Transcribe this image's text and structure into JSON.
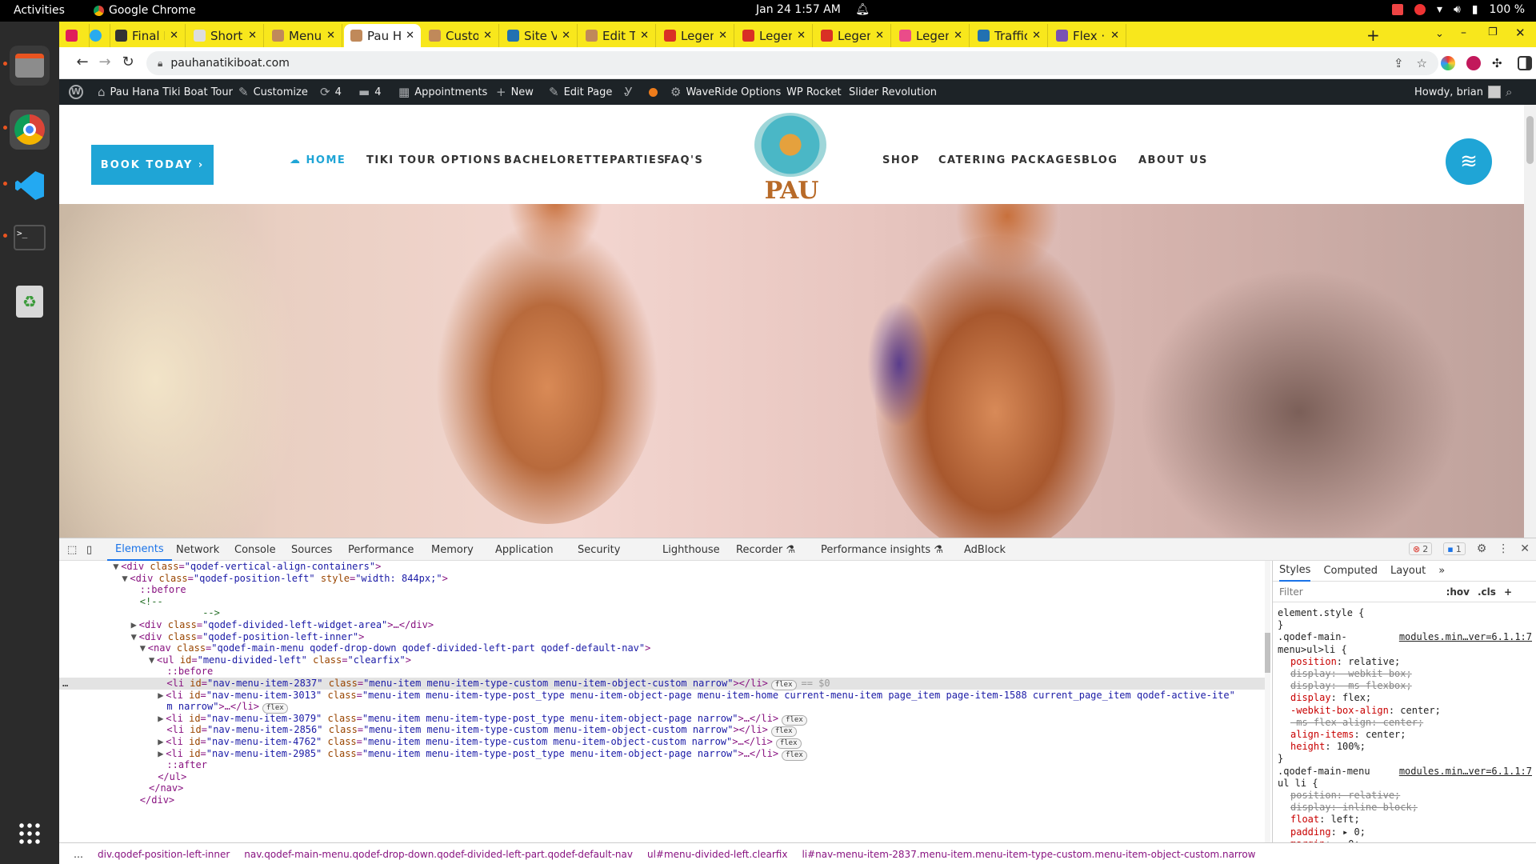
{
  "system_bar": {
    "activities": "Activities",
    "app_name": "Google Chrome",
    "clock": "Jan 24  1:57 AM",
    "battery": "100 %"
  },
  "tabs": [
    {
      "title": "",
      "favicon_color": "#e01e5a"
    },
    {
      "title": "",
      "favicon_color": "#2aabee"
    },
    {
      "title": "Final De",
      "favicon_color": "#333333"
    },
    {
      "title": "Short Sl",
      "favicon_color": "#dddddd"
    },
    {
      "title": "Menus «",
      "favicon_color": "#c0895a"
    },
    {
      "title": "Pau Han",
      "favicon_color": "#c0895a",
      "active": true
    },
    {
      "title": "Custom",
      "favicon_color": "#c0895a"
    },
    {
      "title": "Site Ver",
      "favicon_color": "#2271b1"
    },
    {
      "title": "Edit The",
      "favicon_color": "#c0895a"
    },
    {
      "title": "Legend",
      "favicon_color": "#d93025"
    },
    {
      "title": "Legend",
      "favicon_color": "#d93025"
    },
    {
      "title": "Legend",
      "favicon_color": "#d93025"
    },
    {
      "title": "Legend",
      "favicon_color": "#ea4c89"
    },
    {
      "title": "Traffic S",
      "favicon_color": "#2271b1"
    },
    {
      "title": "Flex · Bo",
      "favicon_color": "#7952b3"
    }
  ],
  "omnibox": {
    "url": "pauhanatikiboat.com"
  },
  "wp_admin_bar": {
    "site_name": "Pau Hana Tiki Boat Tour",
    "customize": "Customize",
    "updates_count": "4",
    "comments_count": "4",
    "appointments": "Appointments",
    "new": "New",
    "edit_page": "Edit Page",
    "waveride": "WaveRide Options",
    "wp_rocket": "WP Rocket",
    "slider_revolution": "Slider Revolution",
    "howdy": "Howdy, brian"
  },
  "site": {
    "book_button": "BOOK TODAY ›",
    "menu_left": [
      "HOME",
      "TIKI TOUR OPTIONS",
      "BACHELORETTEPARTIES",
      "FAQ'S"
    ],
    "menu_right": [
      "SHOP",
      "CATERING PACKAGES",
      "BLOG",
      "ABOUT US"
    ],
    "logo_text": "PAU HANA",
    "accent_color": "#1fa5d6"
  },
  "devtools": {
    "tabs": [
      "Elements",
      "Network",
      "Console",
      "Sources",
      "Performance",
      "Memory",
      "Application",
      "Security",
      "Lighthouse",
      "Recorder",
      "Performance insights",
      "AdBlock"
    ],
    "error_count": "2",
    "message_count": "1",
    "dom_lines": [
      {
        "indent": 6,
        "tri": "▼",
        "open": "<div ",
        "attrs": [
          [
            "class",
            "qodef-vertical-align-containers"
          ]
        ],
        "close": ">",
        "after": ""
      },
      {
        "indent": 7,
        "tri": "▼",
        "open": "<div ",
        "attrs": [
          [
            "class",
            "qodef-position-left"
          ],
          [
            "style",
            "width: 844px;"
          ]
        ],
        "close": ">",
        "after": ""
      },
      {
        "indent": 9,
        "tri": "",
        "pseudo": "::before"
      },
      {
        "indent": 9,
        "tri": "",
        "comment": "<!--"
      },
      {
        "indent": 16,
        "tri": "",
        "comment": "-->"
      },
      {
        "indent": 8,
        "tri": "▶",
        "open": "<div ",
        "attrs": [
          [
            "class",
            "qodef-divided-left-widget-area"
          ]
        ],
        "close": ">…</div>",
        "after": ""
      },
      {
        "indent": 8,
        "tri": "▼",
        "open": "<div ",
        "attrs": [
          [
            "class",
            "qodef-position-left-inner"
          ]
        ],
        "close": ">",
        "after": ""
      },
      {
        "indent": 9,
        "tri": "▼",
        "open": "<nav ",
        "attrs": [
          [
            "class",
            "qodef-main-menu qodef-drop-down qodef-divided-left-part qodef-default-nav"
          ]
        ],
        "close": ">",
        "after": ""
      },
      {
        "indent": 10,
        "tri": "▼",
        "open": "<ul ",
        "attrs": [
          [
            "id",
            "menu-divided-left"
          ],
          [
            "class",
            "clearfix"
          ]
        ],
        "close": ">",
        "after": ""
      },
      {
        "indent": 12,
        "tri": "",
        "pseudo": "::before"
      },
      {
        "indent": 12,
        "tri": "",
        "open": "<li ",
        "attrs": [
          [
            "id",
            "nav-menu-item-2837"
          ],
          [
            "class",
            "menu-item menu-item-type-custom menu-item-object-custom  narrow"
          ]
        ],
        "close": "></li>",
        "pill": "flex",
        "after": "== $0",
        "highlight": true
      },
      {
        "indent": 11,
        "tri": "▶",
        "open": "<li ",
        "attrs": [
          [
            "id",
            "nav-menu-item-3013"
          ],
          [
            "class",
            "menu-item menu-item-type-post_type menu-item-object-page menu-item-home current-menu-item page_item page-item-1588 current_page_item qodef-active-ite"
          ]
        ],
        "close": "",
        "after": ""
      },
      {
        "indent": 12,
        "tri": "",
        "wrap": "m narrow\">…</li>",
        "pill": "flex"
      },
      {
        "indent": 11,
        "tri": "▶",
        "open": "<li ",
        "attrs": [
          [
            "id",
            "nav-menu-item-3079"
          ],
          [
            "class",
            "menu-item menu-item-type-post_type menu-item-object-page  narrow"
          ]
        ],
        "close": ">…</li>",
        "pill": "flex"
      },
      {
        "indent": 12,
        "tri": "",
        "open": "<li ",
        "attrs": [
          [
            "id",
            "nav-menu-item-2856"
          ],
          [
            "class",
            "menu-item menu-item-type-custom menu-item-object-custom  narrow"
          ]
        ],
        "close": "></li>",
        "pill": "flex"
      },
      {
        "indent": 11,
        "tri": "▶",
        "open": "<li ",
        "attrs": [
          [
            "id",
            "nav-menu-item-4762"
          ],
          [
            "class",
            "menu-item menu-item-type-custom menu-item-object-custom  narrow"
          ]
        ],
        "close": ">…</li>",
        "pill": "flex"
      },
      {
        "indent": 11,
        "tri": "▶",
        "open": "<li ",
        "attrs": [
          [
            "id",
            "nav-menu-item-2985"
          ],
          [
            "class",
            "menu-item menu-item-type-post_type menu-item-object-page  narrow"
          ]
        ],
        "close": ">…</li>",
        "pill": "flex"
      },
      {
        "indent": 12,
        "tri": "",
        "pseudo": "::after"
      },
      {
        "indent": 11,
        "tri": "",
        "endtag": "</ul>"
      },
      {
        "indent": 10,
        "tri": "",
        "endtag": "</nav>"
      },
      {
        "indent": 9,
        "tri": "",
        "endtag": "</div>"
      }
    ],
    "styles_tabs": [
      "Styles",
      "Computed",
      "Layout"
    ],
    "filter_placeholder": "Filter",
    "filter_buttons": [
      ":hov",
      ".cls"
    ],
    "style_lines": [
      {
        "t": "element.style {"
      },
      {
        "t": "}"
      },
      {
        "t": ".qodef-main-",
        "src": "modules.min…ver=6.1.1:7"
      },
      {
        "t": "menu>ul>li {"
      },
      {
        "p": "position",
        "v": "relative;"
      },
      {
        "p": "display",
        "v": "-webkit-box;",
        "strike": true
      },
      {
        "p": "display",
        "v": "-ms-flexbox;",
        "strike": true
      },
      {
        "p": "display",
        "v": "flex;"
      },
      {
        "p": "-webkit-box-align",
        "v": "center;"
      },
      {
        "p": "-ms-flex-align",
        "v": "center;",
        "strike": true
      },
      {
        "p": "align-items",
        "v": "center;"
      },
      {
        "p": "height",
        "v": "100%;"
      },
      {
        "t": "}"
      },
      {
        "t": ".qodef-main-menu",
        "src": "modules.min…ver=6.1.1:7"
      },
      {
        "t": "ul li {"
      },
      {
        "p": "position",
        "v": "relative;",
        "strike": true
      },
      {
        "p": "display",
        "v": "inline-block;",
        "strike": true
      },
      {
        "p": "float",
        "v": "left;"
      },
      {
        "p": "padding",
        "v": "▸ 0;"
      },
      {
        "p": "margin",
        "v": "▸ 0;"
      },
      {
        "t": "}"
      }
    ],
    "breadcrumbs": [
      "…",
      "div.qodef-position-left-inner",
      "nav.qodef-main-menu.qodef-drop-down.qodef-divided-left-part.qodef-default-nav",
      "ul#menu-divided-left.clearfix",
      "li#nav-menu-item-2837.menu-item.menu-item-type-custom.menu-item-object-custom.narrow"
    ]
  }
}
